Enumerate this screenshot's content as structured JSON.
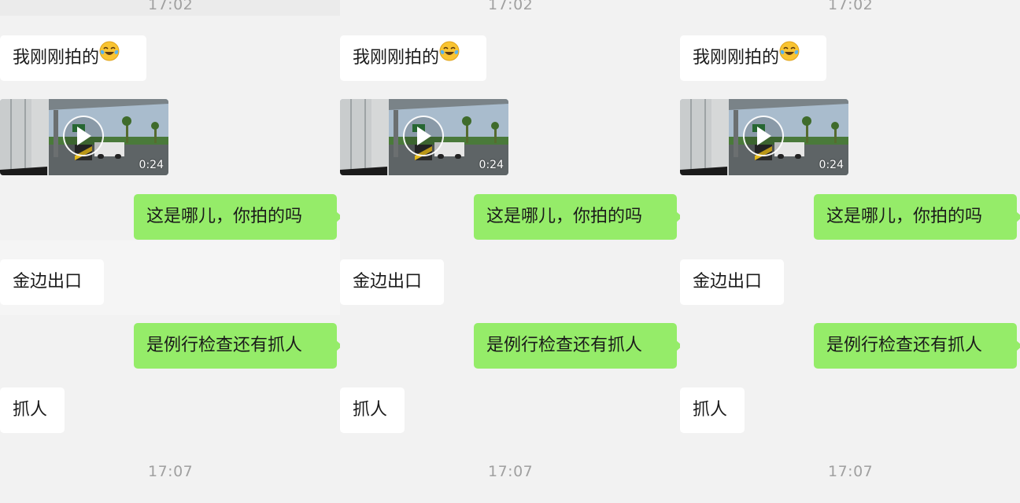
{
  "chat": {
    "time_top": "17:02",
    "time_bottom": "17:07",
    "messages": [
      {
        "side": "in",
        "text": "我刚刚拍的",
        "emoji": "face-with-tears-of-joy-icon"
      },
      {
        "side": "in",
        "type": "video",
        "duration": "0:24"
      },
      {
        "side": "out",
        "text": "这是哪儿，你拍的吗"
      },
      {
        "side": "in",
        "text": "金边出口"
      },
      {
        "side": "out",
        "text": "是例行检查还有抓人"
      },
      {
        "side": "in",
        "text": "抓人"
      }
    ]
  },
  "colors": {
    "incoming_bubble": "#ffffff",
    "outgoing_bubble": "#95ec69",
    "background": "#f2f2f2",
    "timestamp": "#a0a0a0"
  }
}
